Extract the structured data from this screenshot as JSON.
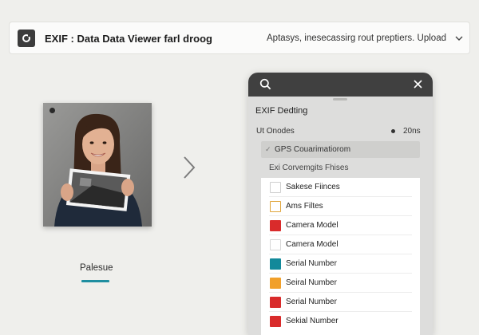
{
  "header": {
    "title": "EXIF : Data Data Viewer farl droog",
    "right_text": "Aptasys, inesecassirg rout preptiers. Upload"
  },
  "preview": {
    "label": "Palesue"
  },
  "panel": {
    "title": "EXIF Dedting",
    "row_label": "Ut Onodes",
    "row_value": "20ns",
    "gps_label": "GPS Couarimatiorom",
    "sub_label": "Exi Corvemgits Fhises",
    "items": [
      {
        "label": "Sakese Fiinces",
        "color": "#ffffff",
        "border": "#cfcfcf"
      },
      {
        "label": "Ams Filtes",
        "color": "#ffffff",
        "border": "#e0a43a"
      },
      {
        "label": "Camera Model",
        "color": "#d92b2b",
        "border": "#d92b2b"
      },
      {
        "label": "Camera Model",
        "color": "#ffffff",
        "border": "#d6d6d6"
      },
      {
        "label": "Serial Number",
        "color": "#12899a",
        "border": "#12899a"
      },
      {
        "label": "Seiral Number",
        "color": "#f1a02a",
        "border": "#f1a02a"
      },
      {
        "label": "Serial Number",
        "color": "#d92b2b",
        "border": "#d92b2b"
      },
      {
        "label": "Sekial Number",
        "color": "#d92b2b",
        "border": "#d92b2b"
      }
    ]
  },
  "icons": {
    "app": "camera-icon",
    "header_chevron": "chevron-down-icon",
    "nav": "chevron-right-icon",
    "search": "search-icon",
    "close": "close-icon"
  }
}
